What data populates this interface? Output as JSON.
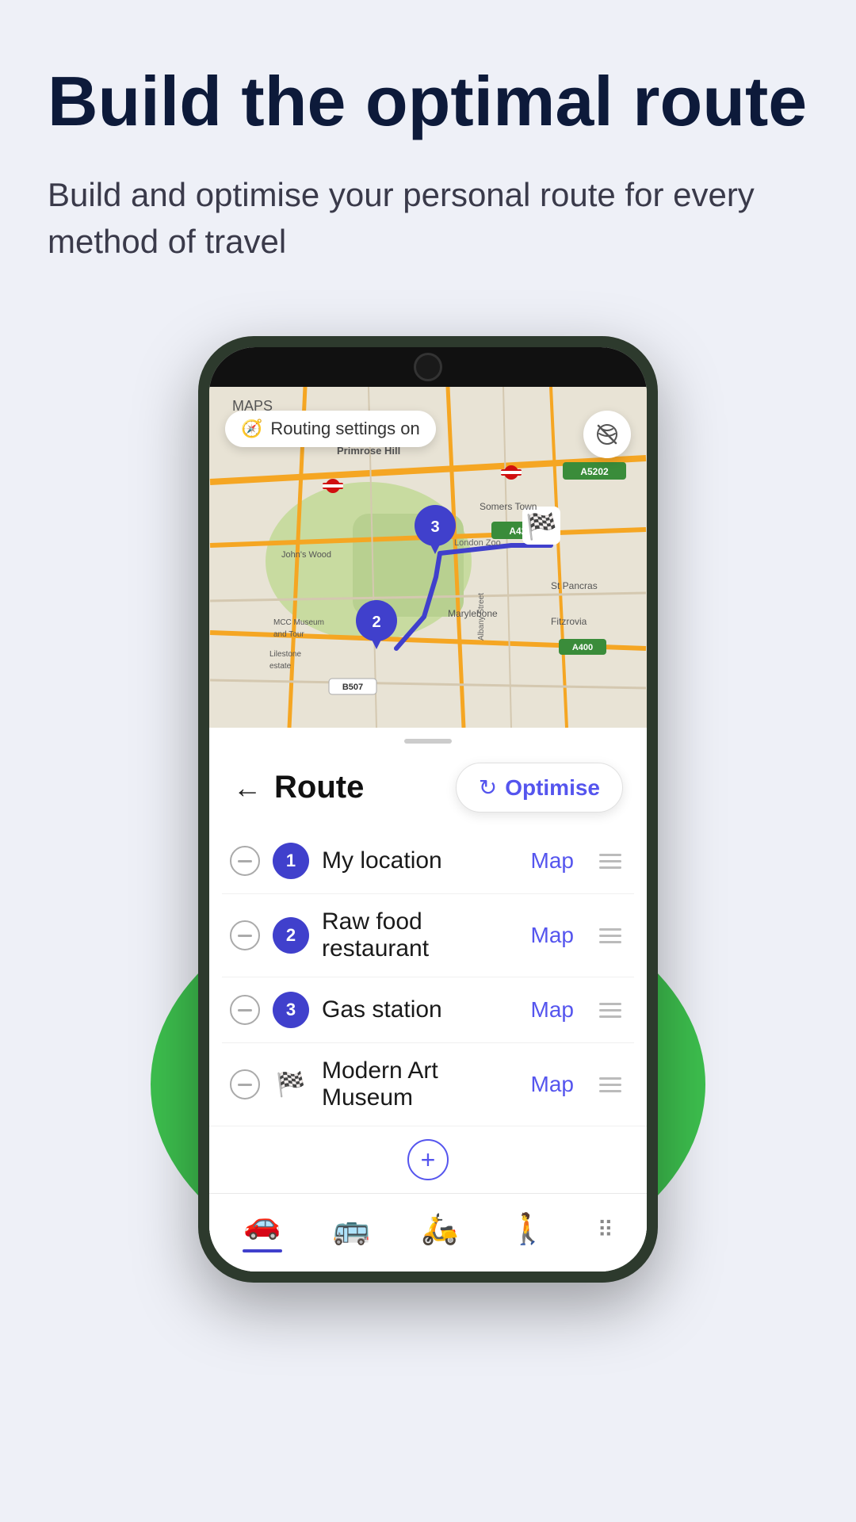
{
  "page": {
    "main_title": "Build the optimal route",
    "subtitle": "Build and optimise your personal route for every method of travel"
  },
  "map": {
    "routing_badge_text": "Routing settings on"
  },
  "route": {
    "back_label": "←",
    "title": "Route",
    "optimise_button_label": "Optimise",
    "stops": [
      {
        "id": 1,
        "type": "number",
        "number": "1",
        "name": "My location",
        "map_link": "Map"
      },
      {
        "id": 2,
        "type": "number",
        "number": "2",
        "name": "Raw food restaurant",
        "map_link": "Map"
      },
      {
        "id": 3,
        "type": "number",
        "number": "3",
        "name": "Gas station",
        "map_link": "Map"
      },
      {
        "id": 4,
        "type": "flag",
        "number": null,
        "name": "Modern Art Museum",
        "map_link": "Map"
      }
    ]
  },
  "nav": {
    "items": [
      "car",
      "bus",
      "bike",
      "walk",
      "dots"
    ]
  }
}
